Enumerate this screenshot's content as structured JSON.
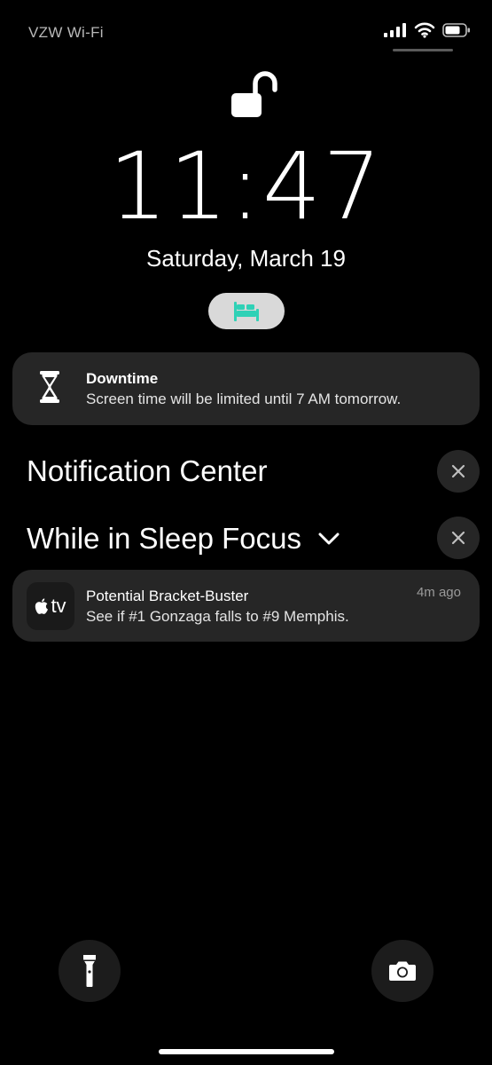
{
  "status_bar": {
    "carrier": "VZW Wi-Fi",
    "icons": [
      "cellular-signal-icon",
      "wifi-icon",
      "battery-icon"
    ],
    "battery_level": 0.75
  },
  "lock_screen": {
    "lock_state": "unlocked",
    "time": "11:47",
    "date": "Saturday, March 19",
    "focus_icon": "bed-icon",
    "focus_icon_color": "#2fd1b6"
  },
  "downtime_banner": {
    "icon": "hourglass-icon",
    "title": "Downtime",
    "message": "Screen time will be limited until 7 AM tomorrow."
  },
  "notification_center": {
    "title": "Notification Center",
    "clear_icon": "close-icon"
  },
  "sleep_focus_section": {
    "title": "While in Sleep Focus",
    "toggle_icon": "chevron-down-icon",
    "clear_icon": "close-icon",
    "notifications": [
      {
        "app": "Apple TV",
        "app_icon_text": "tv",
        "title": "Potential Bracket-Buster",
        "body": "See if #1 Gonzaga falls to #9 Memphis.",
        "time": "4m ago"
      }
    ]
  },
  "bottom_controls": {
    "left_icon": "flashlight-icon",
    "right_icon": "camera-icon"
  }
}
